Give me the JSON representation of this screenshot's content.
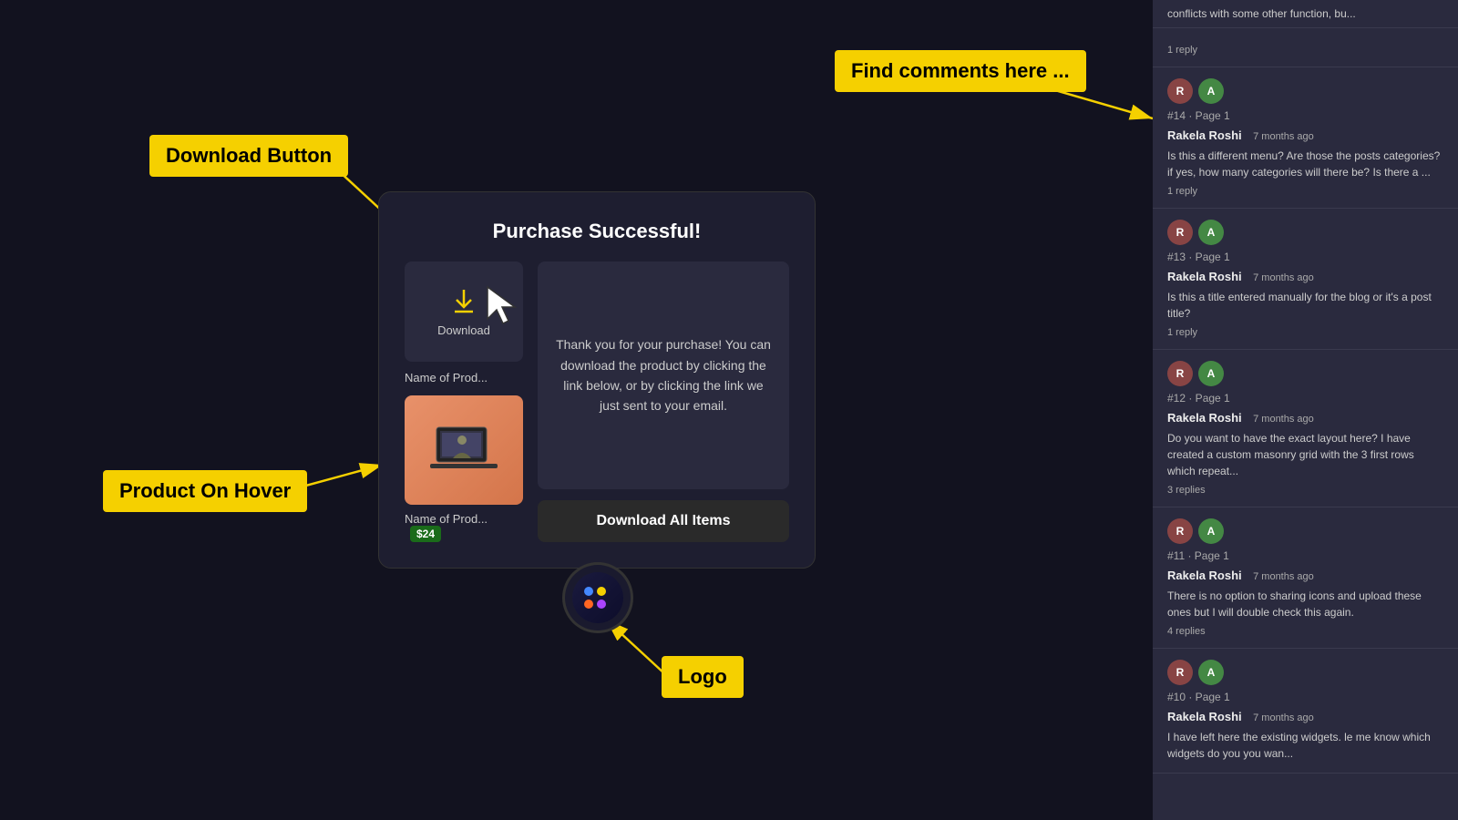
{
  "main": {
    "background": "#12121f"
  },
  "annotations": {
    "download_button_label": "Download Button",
    "product_on_hover_label": "Product On Hover",
    "find_comments_label": "Find comments here ...",
    "logo_label": "Logo"
  },
  "modal": {
    "title": "Purchase Successful!",
    "download_button_text": "Download",
    "product_name_top": "Name of Prod...",
    "product_name_bottom": "Name of Prod...",
    "price": "$24",
    "body_text": "Thank you for your purchase! You can download the product by clicking the link below, or by clicking the link we just sent to your email.",
    "download_all_label": "Download All Items"
  },
  "sidebar": {
    "top_text": "conflicts with some other function, bu...",
    "items": [
      {
        "page_ref": "#14 · Page 1",
        "author": "Rakela Roshi",
        "time": "7 months ago",
        "text": "Is this a different menu? Are those the posts categories? if yes, how many categories will there be? Is there a ...",
        "replies": "1 reply"
      },
      {
        "page_ref": "#13 · Page 1",
        "author": "Rakela Roshi",
        "time": "7 months ago",
        "text": "Is this a title entered manually for the blog or it's a post title?",
        "replies": "1 reply"
      },
      {
        "page_ref": "#12 · Page 1",
        "author": "Rakela Roshi",
        "time": "7 months ago",
        "text": "Do you want to have the exact layout here? I have created a custom masonry grid with the 3 first rows which repeat...",
        "replies": "3 replies"
      },
      {
        "page_ref": "#11 · Page 1",
        "author": "Rakela Roshi",
        "time": "7 months ago",
        "text": "There is no option to sharing icons and upload these ones but I will double check this again.",
        "replies": "4 replies"
      },
      {
        "page_ref": "#10 · Page 1",
        "author": "Rakela Roshi",
        "time": "7 months ago",
        "text": "I have left here the existing widgets. le me know which widgets do you you wan...",
        "replies": ""
      }
    ]
  }
}
